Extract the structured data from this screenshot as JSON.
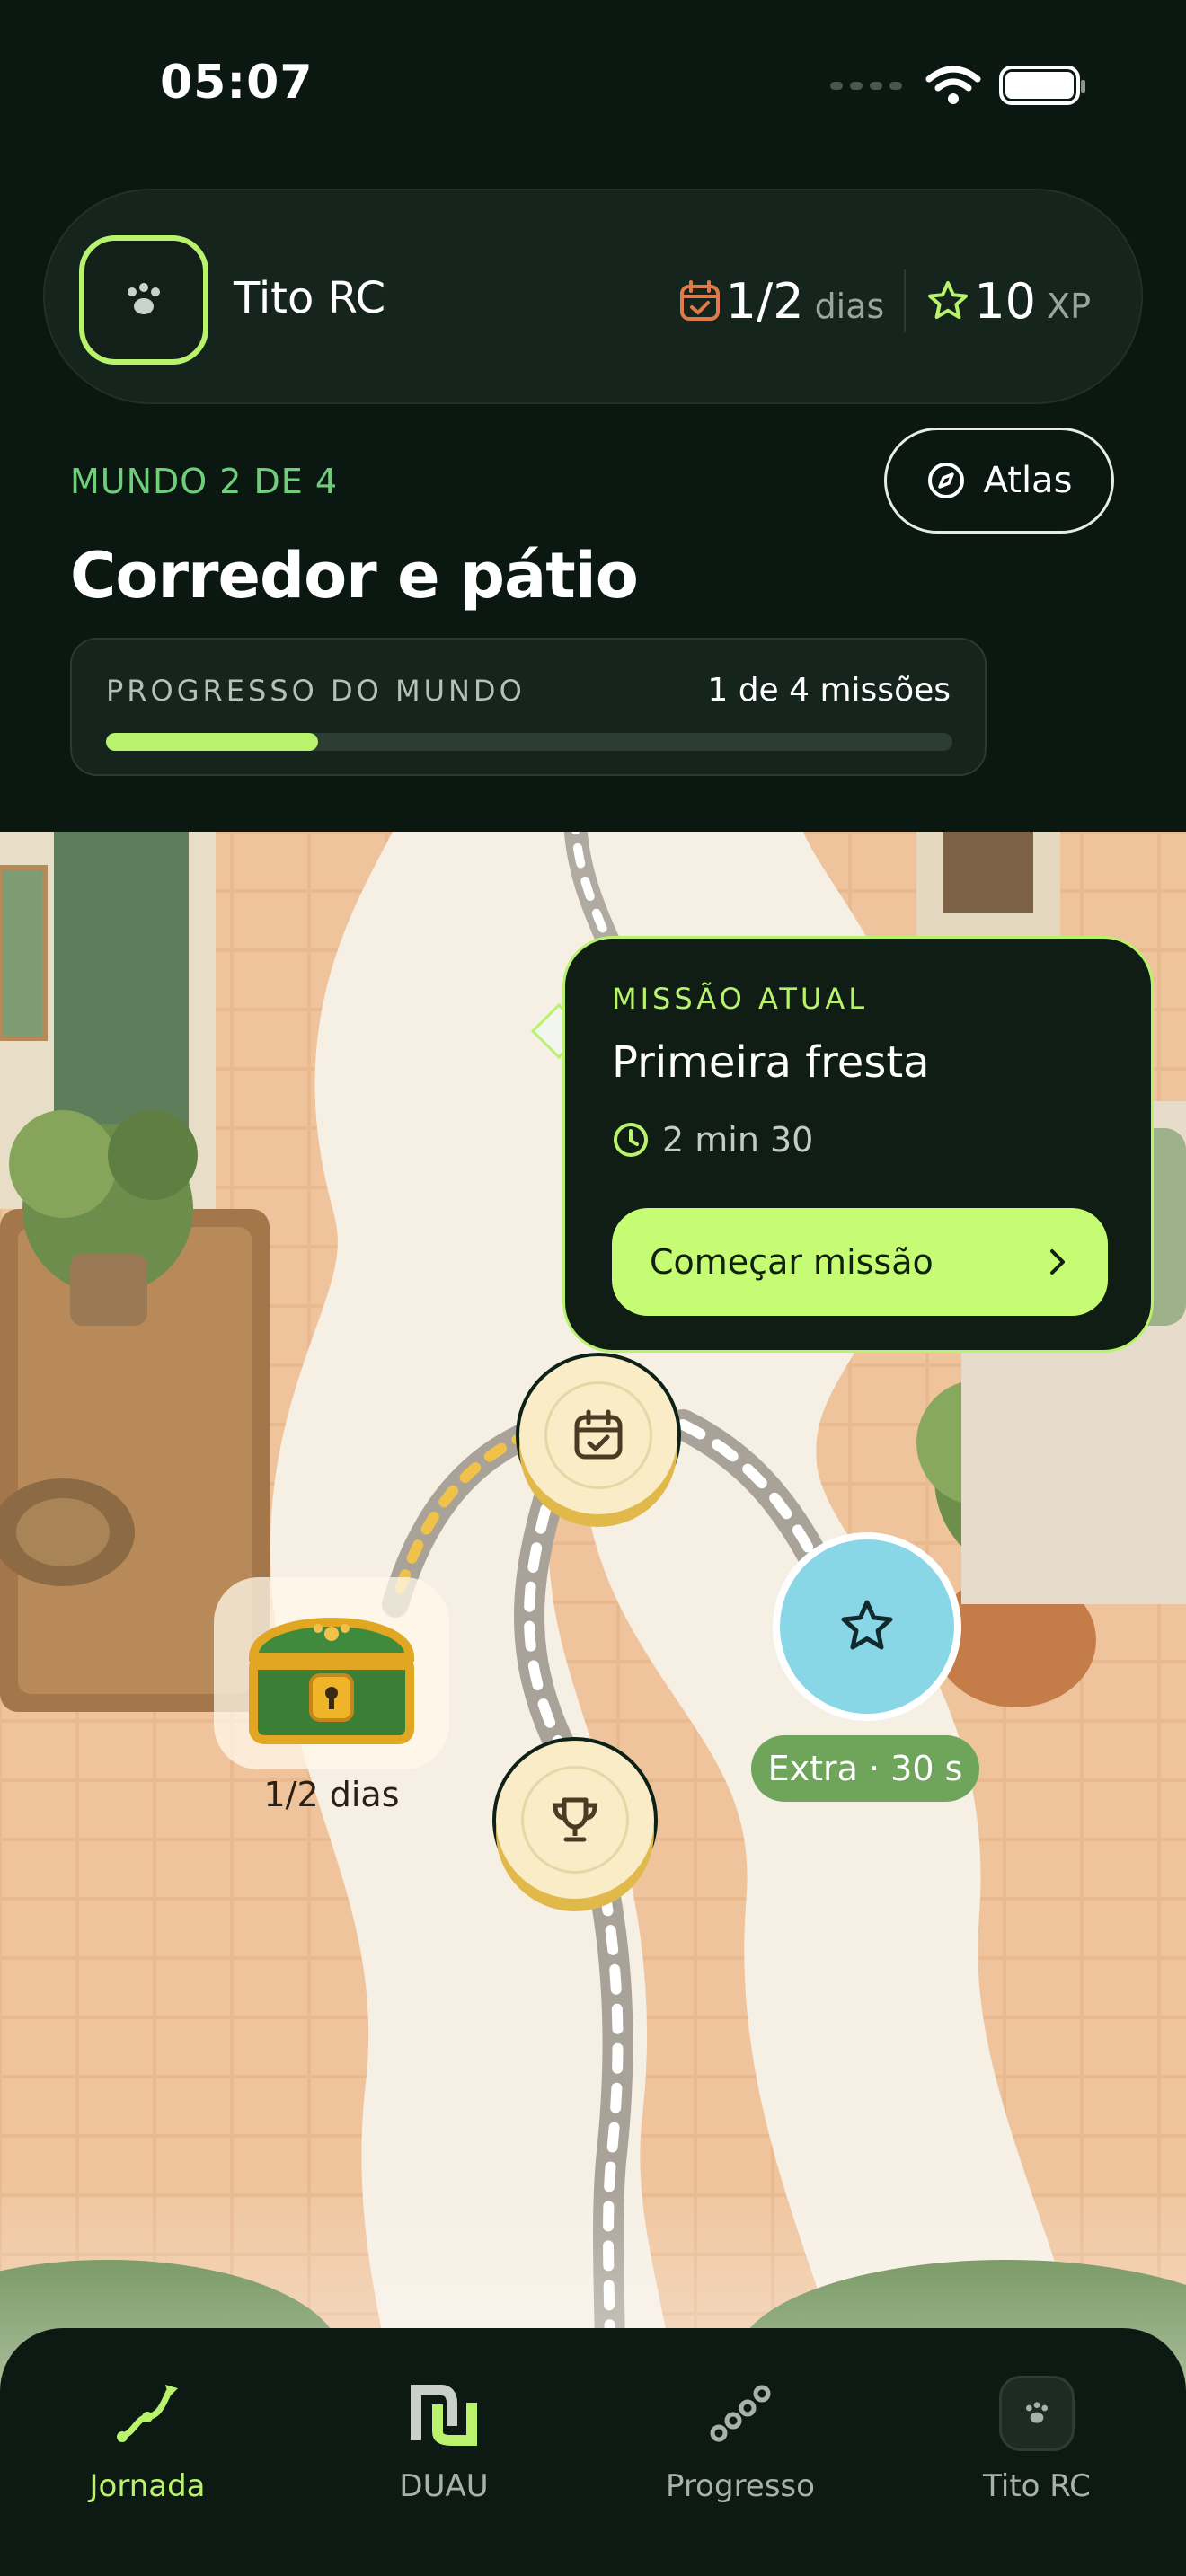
{
  "status_bar": {
    "time": "05:07"
  },
  "profile": {
    "name": "Tito RC",
    "days_value": "1/2",
    "days_unit": "dias",
    "xp_value": "10",
    "xp_unit": "XP"
  },
  "world": {
    "label": "MUNDO 2 DE 4",
    "title": "Corredor e pátio",
    "atlas_label": "Atlas",
    "progress_label": "PROGRESSO DO MUNDO",
    "progress_count": "1 de 4 missões",
    "progress_fraction": 0.25
  },
  "mission": {
    "kicker": "MISSÃO ATUAL",
    "title": "Primeira fresta",
    "duration": "2 min 30",
    "button_label": "Começar missão"
  },
  "map": {
    "chest_label": "1/2 dias",
    "extra_label": "Extra · 30 s",
    "nodes": [
      {
        "name": "calendar-node",
        "icon": "calendar-check-icon"
      },
      {
        "name": "trophy-node",
        "icon": "trophy-icon"
      },
      {
        "name": "extra-star-node",
        "icon": "star-icon"
      },
      {
        "name": "treasure-chest",
        "icon": "treasure-chest-icon"
      }
    ]
  },
  "nav": {
    "items": [
      {
        "label": "Jornada",
        "icon": "journey-path-icon",
        "active": true
      },
      {
        "label": "DUAU",
        "icon": "duau-logo-icon",
        "active": false
      },
      {
        "label": "Progresso",
        "icon": "progress-chain-icon",
        "active": false
      },
      {
        "label": "Tito RC",
        "icon": "paw-avatar-icon",
        "active": false
      }
    ]
  },
  "colors": {
    "accent": "#b9f26d",
    "background": "#0b1711",
    "card": "#15241c",
    "extra": "#88d6e6"
  }
}
